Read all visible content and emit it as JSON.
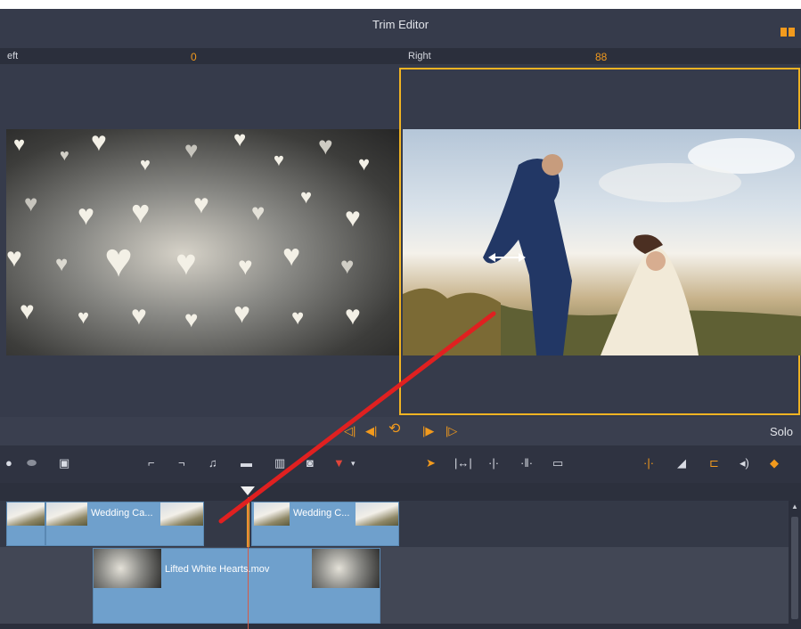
{
  "window": {
    "title": "Trim Editor",
    "layout_icon": "split-view-icon"
  },
  "trim": {
    "left_label": "eft",
    "left_value": "0",
    "right_label": "Right",
    "right_value": "88"
  },
  "transport": {
    "buttons": [
      "go-to-start-icon",
      "step-back-icon",
      "loop-play-icon",
      "step-forward-icon",
      "go-to-end-icon"
    ],
    "solo_label": "Solo"
  },
  "toolbar": {
    "icons": [
      "track-icon",
      "eraser-icon",
      "titles-icon",
      "mark-in-icon",
      "mark-out-icon",
      "audio-ducking-icon",
      "storyboard-icon",
      "delete-icon",
      "snapshot-icon",
      "marker-icon",
      "select-tool-icon",
      "trim-ripple-icon",
      "trim-slip-icon",
      "trim-slide-icon",
      "fit-icon",
      "split-icon",
      "ripple-insert-icon",
      "magnet-icon",
      "audio-icon",
      "color-icon"
    ]
  },
  "timeline": {
    "track1_clips": [
      {
        "label": ""
      },
      {
        "label": "Wedding Ca..."
      },
      {
        "label": "Wedding C..."
      }
    ],
    "track2_clips": [
      {
        "label": "Lifted White Hearts.mov"
      }
    ]
  },
  "colors": {
    "accent": "#f29a1d",
    "frame": "#f0b323",
    "clip": "#6fa0cc",
    "annotation": "#e02020"
  }
}
